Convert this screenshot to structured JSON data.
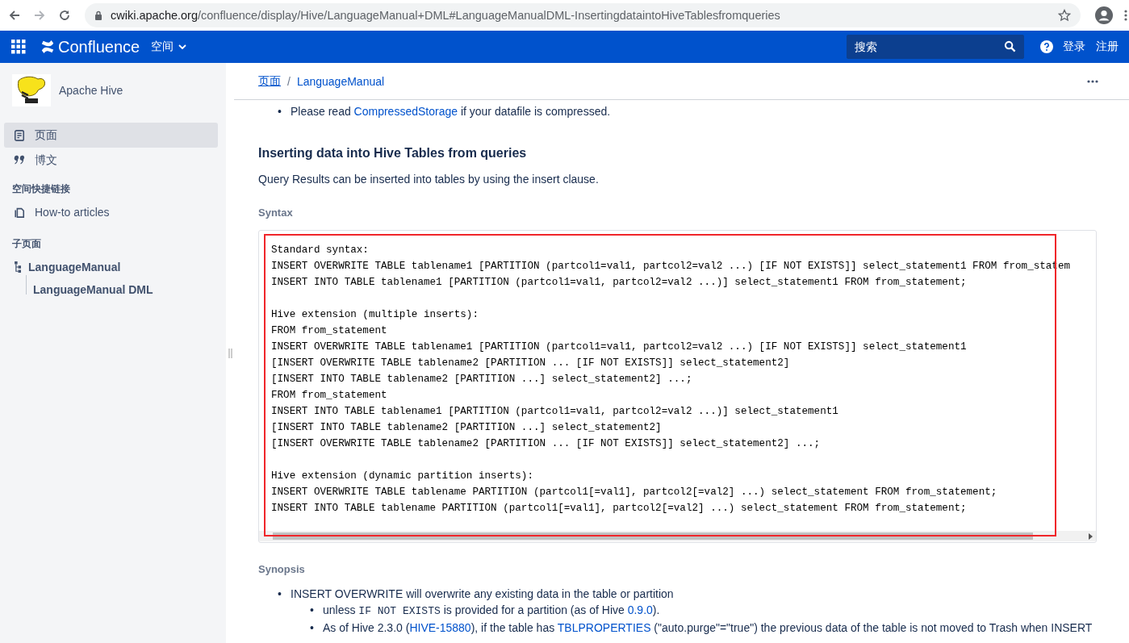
{
  "browser": {
    "host": "cwiki.apache.org",
    "path": "/confluence/display/Hive/LanguageManual+DML#LanguageManualDML-InsertingdataintoHiveTablesfromqueries"
  },
  "header": {
    "product": "Confluence",
    "spaces_menu": "空间",
    "search": {
      "placeholder": "搜索"
    },
    "login": "登录",
    "register": "注册"
  },
  "sidebar": {
    "space_name": "Apache Hive",
    "nav": [
      {
        "label": "页面",
        "kind": "pages",
        "selected": true
      },
      {
        "label": "博文",
        "kind": "blog",
        "selected": false
      }
    ],
    "shortcuts_title": "空间快捷链接",
    "shortcuts": [
      "How-to articles"
    ],
    "children_title": "子页面",
    "tree": [
      {
        "label": "LanguageManual",
        "children": [
          {
            "label": "LanguageManual DML"
          }
        ]
      }
    ]
  },
  "breadcrumb": {
    "separator": "/",
    "items": [
      "页面",
      "LanguageManual"
    ]
  },
  "prelude": [
    {
      "kind": "bullet",
      "marker": "•",
      "parts": [
        {
          "kind": "text",
          "text": "Please read "
        },
        {
          "kind": "link",
          "text": "CompressedStorage"
        },
        {
          "kind": "text",
          "text": " if your datafile is compressed."
        }
      ]
    }
  ],
  "section": {
    "title": "Inserting data into Hive Tables from queries",
    "intro": "Query Results can be inserted into tables by using the insert clause.",
    "syntax_label": "Syntax"
  },
  "code": {
    "highlighted": true,
    "groups": [
      [
        "Standard syntax:",
        "INSERT OVERWRITE TABLE tablename1 [PARTITION (partcol1=val1, partcol2=val2 ...) [IF NOT EXISTS]] select_statement1 FROM from_statem",
        "INSERT INTO TABLE tablename1 [PARTITION (partcol1=val1, partcol2=val2 ...)] select_statement1 FROM from_statement;"
      ],
      [
        "Hive extension (multiple inserts):",
        "FROM from_statement",
        "INSERT OVERWRITE TABLE tablename1 [PARTITION (partcol1=val1, partcol2=val2 ...) [IF NOT EXISTS]] select_statement1",
        "[INSERT OVERWRITE TABLE tablename2 [PARTITION ... [IF NOT EXISTS]] select_statement2]",
        "[INSERT INTO TABLE tablename2 [PARTITION ...] select_statement2] ...;",
        "FROM from_statement",
        "INSERT INTO TABLE tablename1 [PARTITION (partcol1=val1, partcol2=val2 ...)] select_statement1",
        "[INSERT INTO TABLE tablename2 [PARTITION ...] select_statement2]",
        "[INSERT OVERWRITE TABLE tablename2 [PARTITION ... [IF NOT EXISTS]] select_statement2] ...;"
      ],
      [
        "Hive extension (dynamic partition inserts):",
        "INSERT OVERWRITE TABLE tablename PARTITION (partcol1[=val1], partcol2[=val2] ...) select_statement FROM from_statement;",
        "INSERT INTO TABLE tablename PARTITION (partcol1[=val1], partcol2[=val2] ...) select_statement FROM from_statement;"
      ]
    ]
  },
  "synopsis": {
    "title": "Synopsis",
    "items": [
      {
        "marker": "•",
        "parts": [
          {
            "kind": "text",
            "text": "INSERT OVERWRITE will overwrite any existing data in the table or partition"
          }
        ],
        "children": [
          {
            "marker": "•",
            "parts": [
              {
                "kind": "text",
                "text": "unless "
              },
              {
                "kind": "code",
                "text": "IF NOT EXISTS"
              },
              {
                "kind": "text",
                "text": " is provided for a partition (as of Hive "
              },
              {
                "kind": "link",
                "text": "0.9.0"
              },
              {
                "kind": "text",
                "text": ")."
              }
            ]
          },
          {
            "marker": "•",
            "parts": [
              {
                "kind": "text",
                "text": "As of Hive 2.3.0 ("
              },
              {
                "kind": "link",
                "text": "HIVE-15880"
              },
              {
                "kind": "text",
                "text": "), if the table has "
              },
              {
                "kind": "link",
                "text": "TBLPROPERTIES"
              },
              {
                "kind": "text",
                "text": " (\"auto.purge\"=\"true\") the previous data of the table is not moved to Trash when INSERT"
              }
            ]
          }
        ]
      }
    ]
  }
}
